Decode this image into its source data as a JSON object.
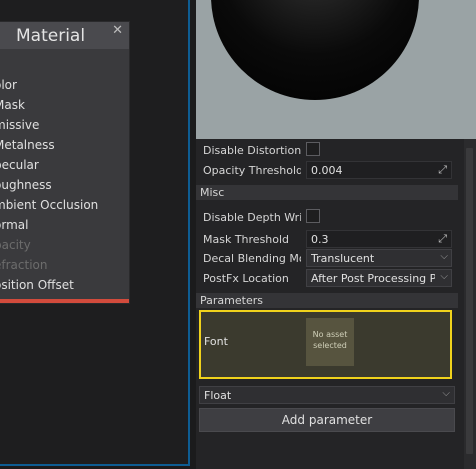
{
  "node": {
    "title": "Material",
    "close_glyph": "✕",
    "accent_color": "#d24b3c",
    "inputs": [
      {
        "label": "olor",
        "disabled": false
      },
      {
        "label": "Mask",
        "disabled": false
      },
      {
        "label": "missive",
        "disabled": false
      },
      {
        "label": "Metalness",
        "disabled": false
      },
      {
        "label": "pecular",
        "disabled": false
      },
      {
        "label": "oughness",
        "disabled": false
      },
      {
        "label": "mbient Occlusion",
        "disabled": false
      },
      {
        "label": "ormal",
        "disabled": false
      },
      {
        "label": "pacity",
        "disabled": true
      },
      {
        "label": "efraction",
        "disabled": true
      },
      {
        "label": "osition Offset",
        "disabled": false
      }
    ]
  },
  "properties": {
    "disable_distortion": {
      "label": "Disable Distortion",
      "checked": false
    },
    "opacity_threshold": {
      "label": "Opacity Threshold",
      "value": "0.004",
      "expand_glyph": "⤢"
    },
    "misc_header": "Misc",
    "disable_depth_write": {
      "label": "Disable Depth Write",
      "checked": false
    },
    "mask_threshold": {
      "label": "Mask Threshold",
      "value": "0.3",
      "expand_glyph": "⤢"
    },
    "decal_blending_mode": {
      "label": "Decal Blending Mode",
      "value": "Translucent",
      "chevron": "⌵"
    },
    "postfx_location": {
      "label": "PostFx Location",
      "value": "After Post Processing Pass",
      "chevron": "⌵"
    },
    "parameters_header": "Parameters",
    "parameter": {
      "name": "Font",
      "asset_text_1": "No asset",
      "asset_text_2": "selected",
      "highlight_color": "#f0d21c"
    },
    "new_param_type": {
      "value": "Float",
      "chevron": "⌵"
    },
    "add_button_label": "Add parameter"
  }
}
